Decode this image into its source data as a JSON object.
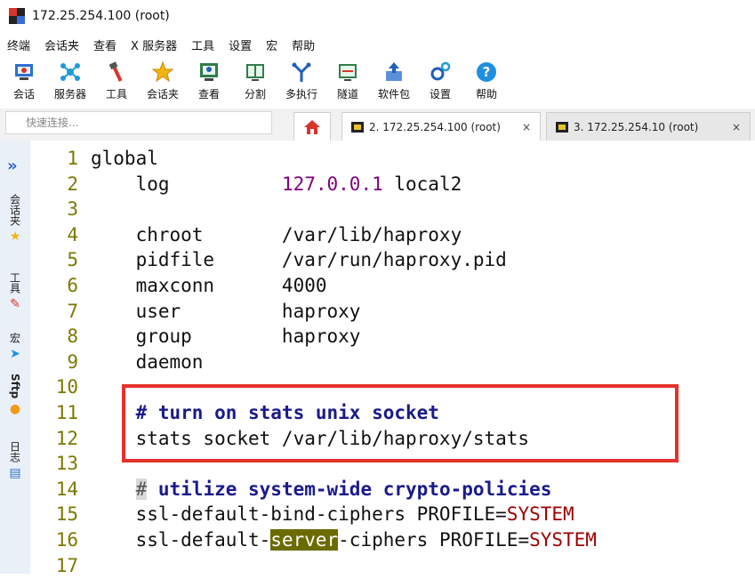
{
  "window": {
    "title": "172.25.254.100 (root)"
  },
  "menu": [
    "终端",
    "会话夹",
    "查看",
    "X 服务器",
    "工具",
    "设置",
    "宏",
    "帮助"
  ],
  "toolbar": [
    {
      "label": "会话",
      "icon": "session-icon"
    },
    {
      "label": "服务器",
      "icon": "servers-icon"
    },
    {
      "label": "工具",
      "icon": "tools-icon"
    },
    {
      "label": "会话夹",
      "icon": "star-icon"
    },
    {
      "label": "查看",
      "icon": "view-icon"
    },
    {
      "label": "分割",
      "icon": "split-icon"
    },
    {
      "label": "多执行",
      "icon": "fork-icon"
    },
    {
      "label": "隧道",
      "icon": "tunnel-icon"
    },
    {
      "label": "软件包",
      "icon": "package-icon"
    },
    {
      "label": "设置",
      "icon": "gears-icon"
    },
    {
      "label": "帮助",
      "icon": "help-icon"
    }
  ],
  "tabs": {
    "quick_connect_placeholder": "快速连接...",
    "session_tabs": [
      {
        "label": "2. 172.25.254.100 (root)",
        "active": true
      },
      {
        "label": "3. 172.25.254.10 (root)",
        "active": false
      }
    ],
    "close_glyph": "×"
  },
  "sidebar": {
    "arrow": "»",
    "items": [
      {
        "label": "会话夹",
        "icon": "star-icon"
      },
      {
        "label": "工具",
        "icon": "tools-icon"
      },
      {
        "label": "宏",
        "icon": "macro-icon"
      },
      {
        "label": "Sftp",
        "icon": "sftp-icon"
      },
      {
        "label": "日志",
        "icon": "log-icon"
      }
    ]
  },
  "editor": {
    "lines": [
      {
        "n": "1",
        "parts": [
          {
            "t": "global",
            "c": "kw"
          }
        ]
      },
      {
        "n": "2",
        "parts": [
          {
            "t": "    log          ",
            "c": "kw"
          },
          {
            "t": "127.0.0.1",
            "c": "num"
          },
          {
            "t": " local2",
            "c": "kw"
          }
        ]
      },
      {
        "n": "3",
        "parts": []
      },
      {
        "n": "4",
        "parts": [
          {
            "t": "    chroot       /var/lib/haproxy",
            "c": "kw"
          }
        ]
      },
      {
        "n": "5",
        "parts": [
          {
            "t": "    pidfile      /var/run/haproxy.pid",
            "c": "kw"
          }
        ]
      },
      {
        "n": "6",
        "parts": [
          {
            "t": "    maxconn      4000",
            "c": "kw"
          }
        ]
      },
      {
        "n": "7",
        "parts": [
          {
            "t": "    user         haproxy",
            "c": "kw"
          }
        ]
      },
      {
        "n": "8",
        "parts": [
          {
            "t": "    group        haproxy",
            "c": "kw"
          }
        ]
      },
      {
        "n": "9",
        "parts": [
          {
            "t": "    daemon",
            "c": "kw"
          }
        ]
      },
      {
        "n": "10",
        "parts": []
      },
      {
        "n": "11",
        "parts": [
          {
            "t": "    ",
            "c": "kw"
          },
          {
            "t": "# turn on stats unix socket",
            "c": "cmt"
          }
        ]
      },
      {
        "n": "12",
        "parts": [
          {
            "t": "    stats socket /var/lib/haproxy/stats",
            "c": "kw"
          }
        ]
      },
      {
        "n": "13",
        "parts": []
      },
      {
        "n": "14",
        "parts": [
          {
            "t": "    ",
            "c": "kw"
          },
          {
            "t": "#",
            "c": "hash-box"
          },
          {
            "t": " utilize system-wide crypto-policies",
            "c": "cmt"
          }
        ]
      },
      {
        "n": "15",
        "parts": [
          {
            "t": "    ssl-default-bind-ciphers PROFILE=",
            "c": "kw"
          },
          {
            "t": "SYSTEM",
            "c": "red"
          }
        ]
      },
      {
        "n": "16",
        "parts": [
          {
            "t": "    ssl-default-",
            "c": "kw"
          },
          {
            "t": "server",
            "c": "hl"
          },
          {
            "t": "-ciphers PROFILE=",
            "c": "kw"
          },
          {
            "t": "SYSTEM",
            "c": "red"
          }
        ]
      },
      {
        "n": "17",
        "parts": []
      }
    ]
  }
}
